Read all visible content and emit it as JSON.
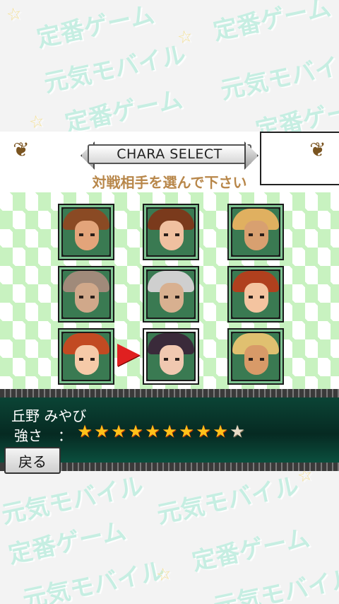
{
  "background": {
    "watermarks": [
      "元気モバイル",
      "定番ゲーム",
      "☆"
    ]
  },
  "header": {
    "title": "CHARA SELECT",
    "subtitle": "対戦相手を選んで下さい"
  },
  "characters": [
    {
      "hair": "#8a4a24",
      "skin": "#e3a47a",
      "bg": "#3a7a52"
    },
    {
      "hair": "#7a3a1c",
      "skin": "#f0c0a0",
      "bg": "#3a7a52"
    },
    {
      "hair": "#e0b060",
      "skin": "#d8a070",
      "bg": "#3a7a52"
    },
    {
      "hair": "#a08a7a",
      "skin": "#d0a88a",
      "bg": "#3a7a52"
    },
    {
      "hair": "#cfcfcf",
      "skin": "#d8b090",
      "bg": "#3a7a52"
    },
    {
      "hair": "#b0401e",
      "skin": "#f4c4a0",
      "bg": "#3a7a52"
    },
    {
      "hair": "#c24a22",
      "skin": "#f6caa8",
      "bg": "#3a7a52"
    },
    {
      "hair": "#3a2a3a",
      "skin": "#f0c8b0",
      "bg": "#3a7a52"
    },
    {
      "hair": "#e0c070",
      "skin": "#d89a68",
      "bg": "#3a7a52"
    }
  ],
  "selected_index": 7,
  "info": {
    "name": "丘野 みやび",
    "strength_label": "強さ",
    "colon": "：",
    "strength": 9,
    "strength_max": 10
  },
  "back_button": "戻る",
  "colors": {
    "accent_text": "#b8874a",
    "cursor": "#e02020",
    "star_on": "#ffc21a"
  }
}
